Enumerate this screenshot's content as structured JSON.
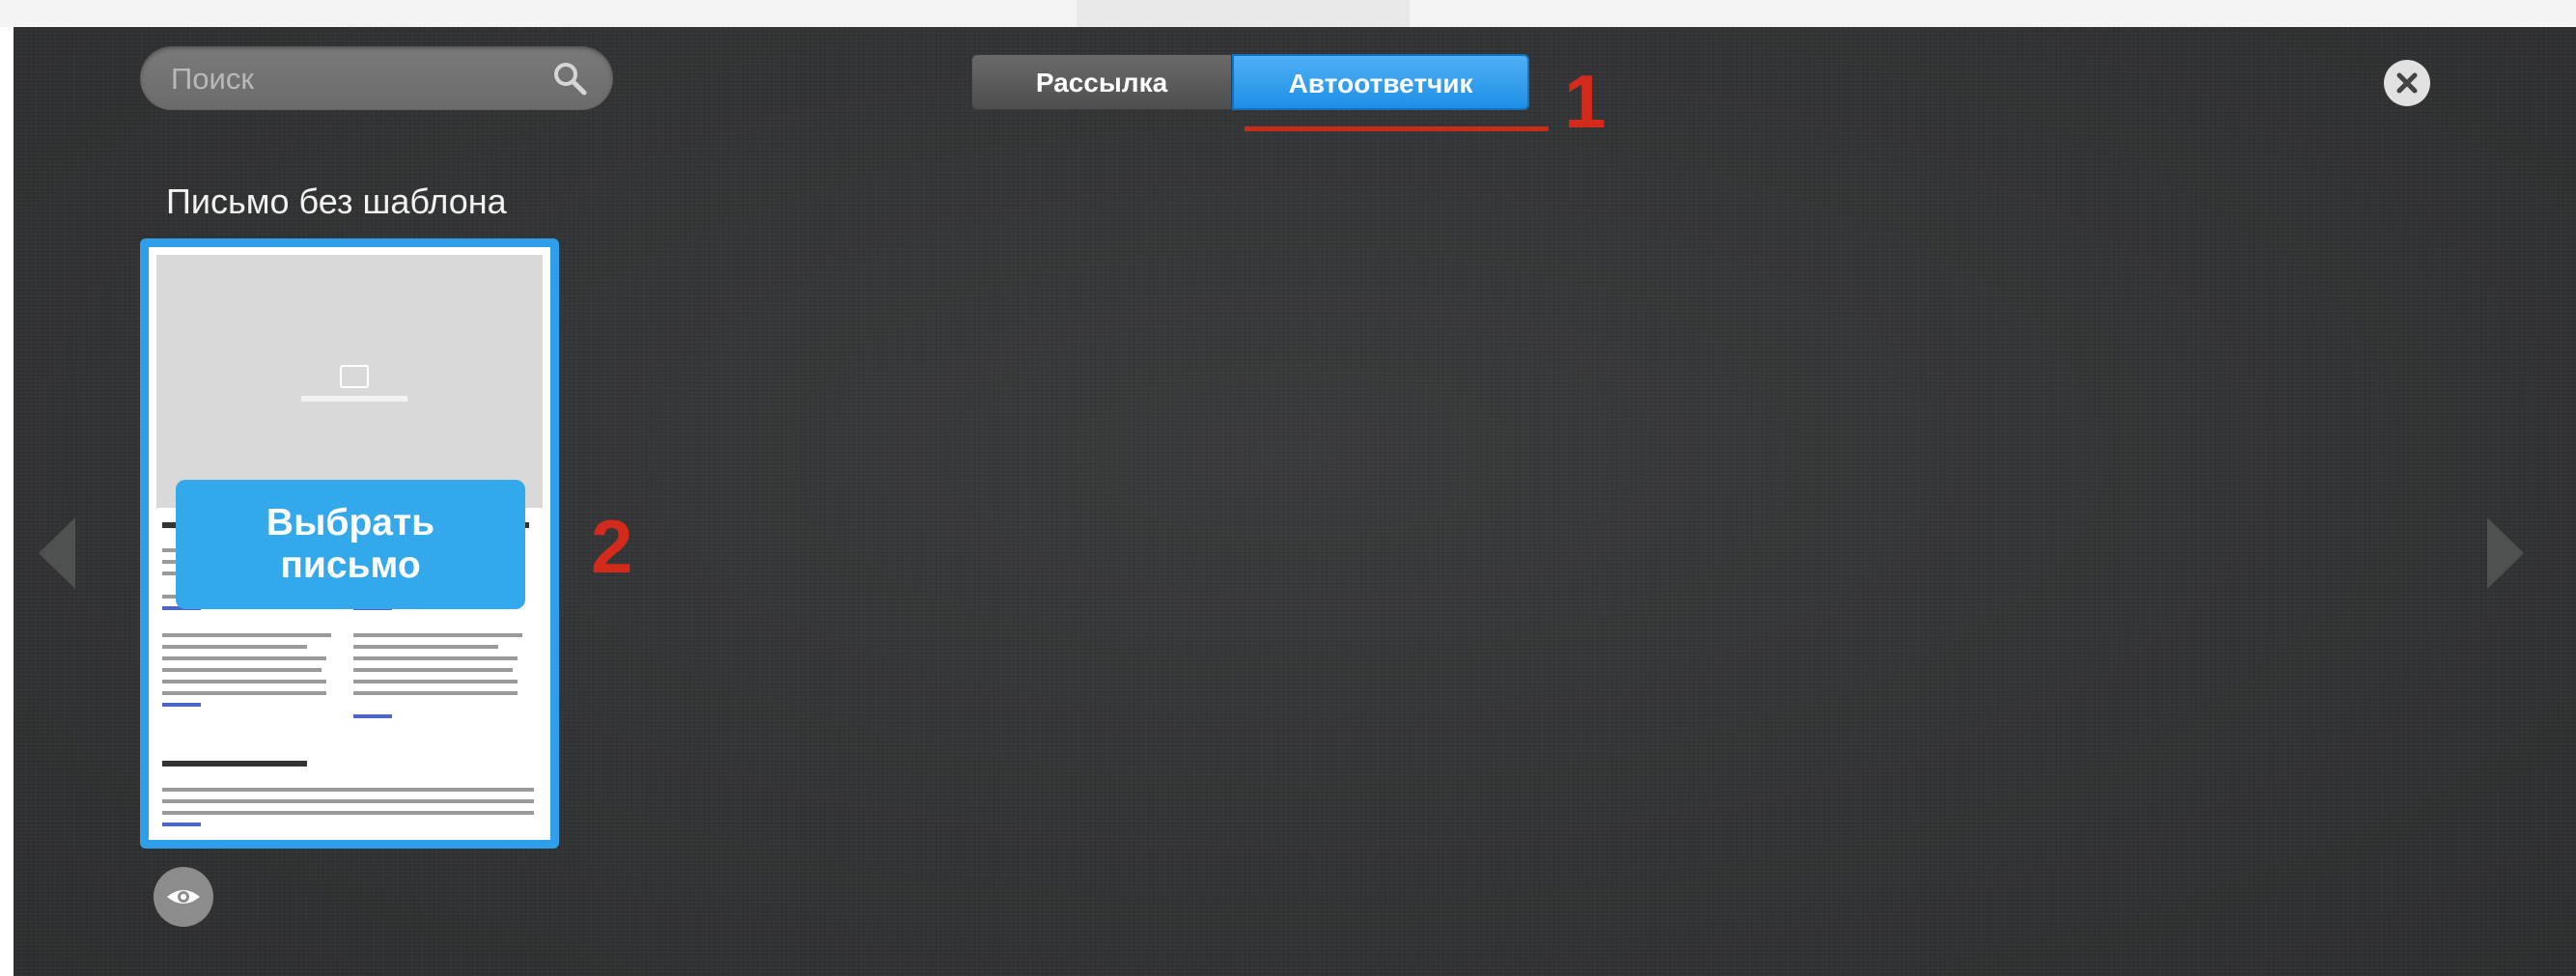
{
  "search": {
    "placeholder": "Поиск",
    "icon": "search-icon"
  },
  "tabs": [
    {
      "label": "Рассылка",
      "active": false
    },
    {
      "label": "Автоответчик",
      "active": true
    }
  ],
  "annotations": {
    "one": "1",
    "two": "2"
  },
  "section_title": "Письмо без шаблона",
  "template_card": {
    "choose_button_line1": "Выбрать",
    "choose_button_line2": "письмо",
    "icon": "image-placeholder-icon"
  },
  "icons": {
    "close": "close-icon",
    "preview": "eye-icon",
    "prev": "chevron-left-icon",
    "next": "chevron-right-icon"
  },
  "colors": {
    "accent": "#2e9fea",
    "annotation": "#d42a1c",
    "background": "#333435"
  }
}
